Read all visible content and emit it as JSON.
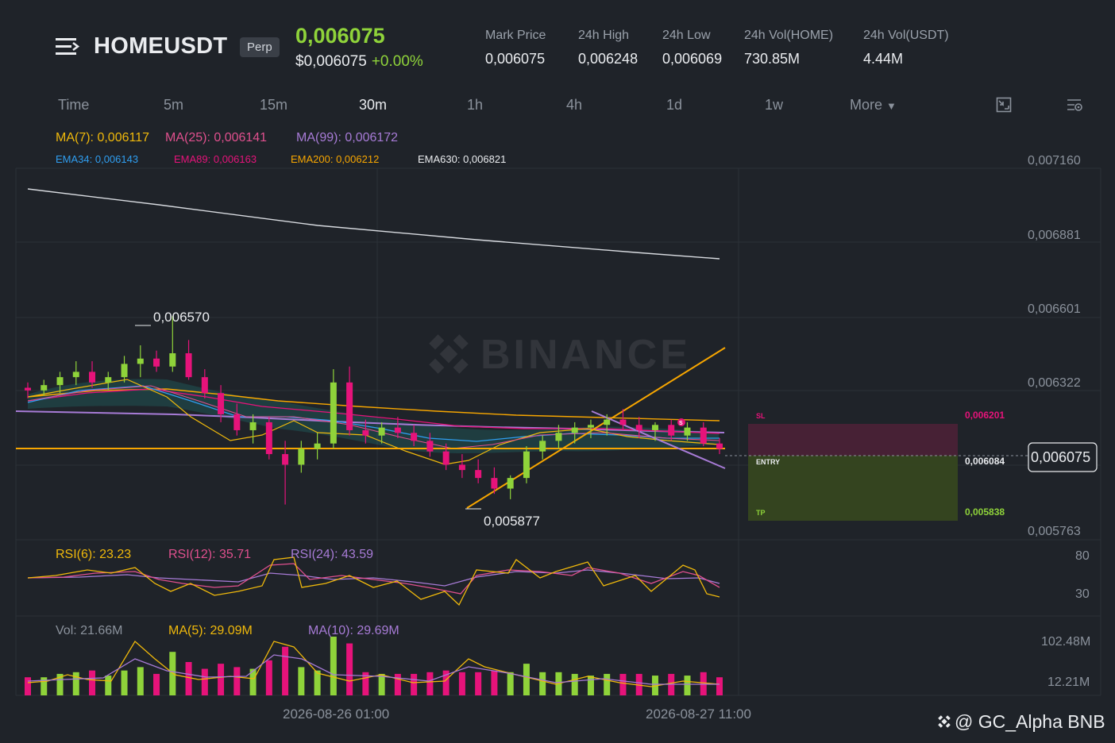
{
  "header": {
    "symbol": "HOMEUSDT",
    "contract_badge": "Perp",
    "last_price": "0,006075",
    "usd_price": "$0,006075",
    "change_pct": "+0.00%",
    "stats": [
      {
        "label": "Mark Price",
        "value": "0,006075"
      },
      {
        "label": "24h High",
        "value": "0,006248"
      },
      {
        "label": "24h Low",
        "value": "0,006069"
      },
      {
        "label": "24h Vol(HOME)",
        "value": "730.85M"
      },
      {
        "label": "24h Vol(USDT)",
        "value": "4.44M"
      }
    ]
  },
  "timeframes": {
    "items": [
      "Time",
      "5m",
      "15m",
      "30m",
      "1h",
      "4h",
      "1d",
      "1w",
      "More"
    ],
    "active": "30m"
  },
  "toolbar": {
    "chart_type_icon": "chart-style-icon",
    "settings_icon": "settings-sliders-icon"
  },
  "indicators": {
    "ma": [
      "MA(7): 0,006117",
      "MA(25): 0,006141",
      "MA(99): 0,006172"
    ],
    "ema": [
      "EMA34: 0,006143",
      "EMA89: 0,006163",
      "EMA200: 0,006212",
      "EMA630: 0,006821"
    ],
    "rsi": [
      "RSI(6): 23.23",
      "RSI(12): 35.71",
      "RSI(24): 43.59"
    ],
    "vol": [
      "Vol: 21.66M",
      "MA(5): 29.09M",
      "MA(10): 29.69M"
    ]
  },
  "price_axis": [
    "0,007160",
    "0,006881",
    "0,006601",
    "0,006322",
    "0,005763"
  ],
  "current_price_tag": "0,006075",
  "rsi_axis": [
    "80",
    "30"
  ],
  "vol_axis": [
    "102.48M",
    "12.21M"
  ],
  "annotations": {
    "high": "0,006570",
    "low": "0,005877",
    "signal_marker": "S"
  },
  "position": {
    "sl_label": "SL",
    "sl_price": "0,006201",
    "entry_label": "ENTRY",
    "entry_price": "0,006084",
    "tp_label": "TP",
    "tp_price": "0,005838"
  },
  "dates": [
    "2026-08-26 01:00",
    "2026-08-27 11:00"
  ],
  "watermark": {
    "logo_text": "BINANCE",
    "credit": "@ GC_Alpha BNB"
  },
  "colors": {
    "up": "#8fd33a",
    "down": "#e6137a",
    "ma7": "#f0b90b",
    "ma25": "#e0508e",
    "ma99": "#a77bd6",
    "ema34": "#2f9ef0",
    "ema89": "#e6137a",
    "ema200": "#f7a600",
    "ema630": "#eaecef"
  },
  "chart_data": {
    "type": "candlestick",
    "ylim": [
      0.005763,
      0.00716
    ],
    "candles_ohlc_approx": [
      [
        0.0063,
        0.00632,
        0.00626,
        0.00629
      ],
      [
        0.00629,
        0.00633,
        0.00627,
        0.00631
      ],
      [
        0.00631,
        0.00636,
        0.00628,
        0.00634
      ],
      [
        0.00634,
        0.0064,
        0.00631,
        0.00636
      ],
      [
        0.00636,
        0.0064,
        0.0063,
        0.00632
      ],
      [
        0.00632,
        0.00636,
        0.00629,
        0.00634
      ],
      [
        0.00634,
        0.00642,
        0.00632,
        0.00639
      ],
      [
        0.00639,
        0.00646,
        0.00634,
        0.00641
      ],
      [
        0.00641,
        0.00644,
        0.00636,
        0.00638
      ],
      [
        0.00638,
        0.00657,
        0.00636,
        0.00643
      ],
      [
        0.00643,
        0.00648,
        0.00633,
        0.00634
      ],
      [
        0.00634,
        0.00637,
        0.00626,
        0.00628
      ],
      [
        0.00628,
        0.00631,
        0.00617,
        0.0062
      ],
      [
        0.0062,
        0.00624,
        0.00612,
        0.00614
      ],
      [
        0.00614,
        0.0062,
        0.00609,
        0.00617
      ],
      [
        0.00617,
        0.00619,
        0.00603,
        0.00605
      ],
      [
        0.00605,
        0.0061,
        0.00586,
        0.00601
      ],
      [
        0.00601,
        0.0061,
        0.00598,
        0.00607
      ],
      [
        0.00607,
        0.00613,
        0.00603,
        0.00609
      ],
      [
        0.00609,
        0.00637,
        0.00607,
        0.00632
      ],
      [
        0.00632,
        0.00638,
        0.00612,
        0.00614
      ],
      [
        0.00614,
        0.00618,
        0.00609,
        0.00612
      ],
      [
        0.00612,
        0.00617,
        0.00609,
        0.00615
      ],
      [
        0.00615,
        0.00619,
        0.00611,
        0.00613
      ],
      [
        0.00613,
        0.00616,
        0.00608,
        0.0061
      ],
      [
        0.0061,
        0.00613,
        0.00604,
        0.00606
      ],
      [
        0.00606,
        0.00609,
        0.00599,
        0.00601
      ],
      [
        0.00601,
        0.00605,
        0.00596,
        0.00599
      ],
      [
        0.00599,
        0.00603,
        0.00594,
        0.00596
      ],
      [
        0.00596,
        0.006,
        0.0059,
        0.00592
      ],
      [
        0.00592,
        0.00597,
        0.00588,
        0.00596
      ],
      [
        0.00596,
        0.00608,
        0.00594,
        0.00606
      ],
      [
        0.00606,
        0.00612,
        0.00603,
        0.0061
      ],
      [
        0.0061,
        0.00616,
        0.00607,
        0.00613
      ],
      [
        0.00613,
        0.00617,
        0.00609,
        0.00615
      ],
      [
        0.00615,
        0.00618,
        0.00611,
        0.00616
      ],
      [
        0.00616,
        0.0062,
        0.00612,
        0.00618
      ],
      [
        0.00618,
        0.00622,
        0.00614,
        0.00616
      ],
      [
        0.00616,
        0.00619,
        0.00611,
        0.00614
      ],
      [
        0.00614,
        0.00617,
        0.0061,
        0.00616
      ],
      [
        0.00616,
        0.00618,
        0.0061,
        0.00612
      ],
      [
        0.00612,
        0.00617,
        0.0061,
        0.00615
      ],
      [
        0.00615,
        0.00617,
        0.00608,
        0.00609
      ],
      [
        0.00609,
        0.00611,
        0.00605,
        0.00607
      ]
    ]
  }
}
